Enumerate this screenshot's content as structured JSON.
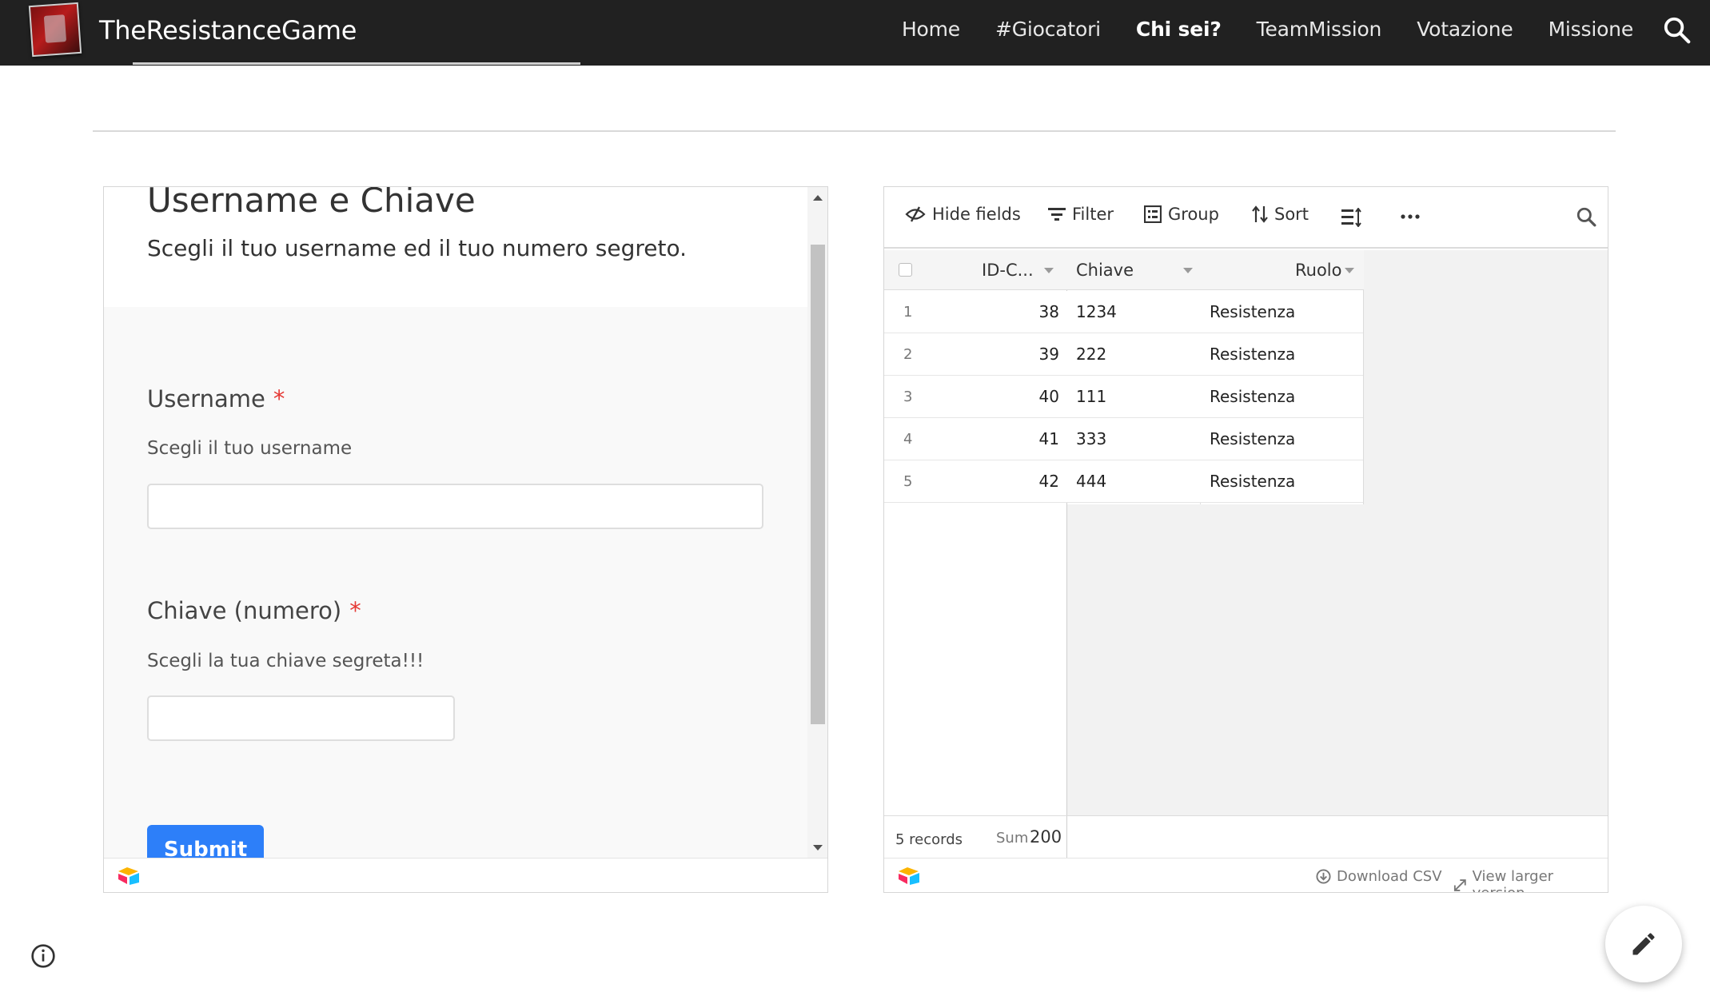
{
  "site": {
    "title": "TheResistanceGame",
    "nav": [
      "Home",
      "#Giocatori",
      "Chi sei?",
      "TeamMission",
      "Votazione",
      "Missione"
    ],
    "active_nav": "Chi sei?"
  },
  "form": {
    "title": "Username e Chiave",
    "description": "Scegli il tuo username ed il tuo numero segreto.",
    "fields": [
      {
        "label": "Username",
        "required_mark": "*",
        "help": "Scegli il tuo username",
        "value": ""
      },
      {
        "label": "Chiave (numero)",
        "required_mark": "*",
        "help": "Scegli la tua chiave segreta!!!",
        "value": ""
      }
    ],
    "submit_label": "Submit"
  },
  "grid": {
    "toolbar": {
      "hide_fields": "Hide fields",
      "filter": "Filter",
      "group": "Group",
      "sort": "Sort"
    },
    "columns": [
      "ID-C...",
      "Chiave",
      "Ruolo"
    ],
    "rows": [
      {
        "num": "1",
        "id": "38",
        "chiave": "1234",
        "ruolo": "Resistenza"
      },
      {
        "num": "2",
        "id": "39",
        "chiave": "222",
        "ruolo": "Resistenza"
      },
      {
        "num": "3",
        "id": "40",
        "chiave": "111",
        "ruolo": "Resistenza"
      },
      {
        "num": "4",
        "id": "41",
        "chiave": "333",
        "ruolo": "Resistenza"
      },
      {
        "num": "5",
        "id": "42",
        "chiave": "444",
        "ruolo": "Resistenza"
      }
    ],
    "summary": {
      "records": "5 records",
      "sum_label": "Sum",
      "sum_value": "200"
    },
    "footer": {
      "download": "Download CSV",
      "larger": "View larger version"
    }
  },
  "colors": {
    "topbar": "#212121",
    "accent": "#2d7ff9",
    "required": "#e53935"
  }
}
